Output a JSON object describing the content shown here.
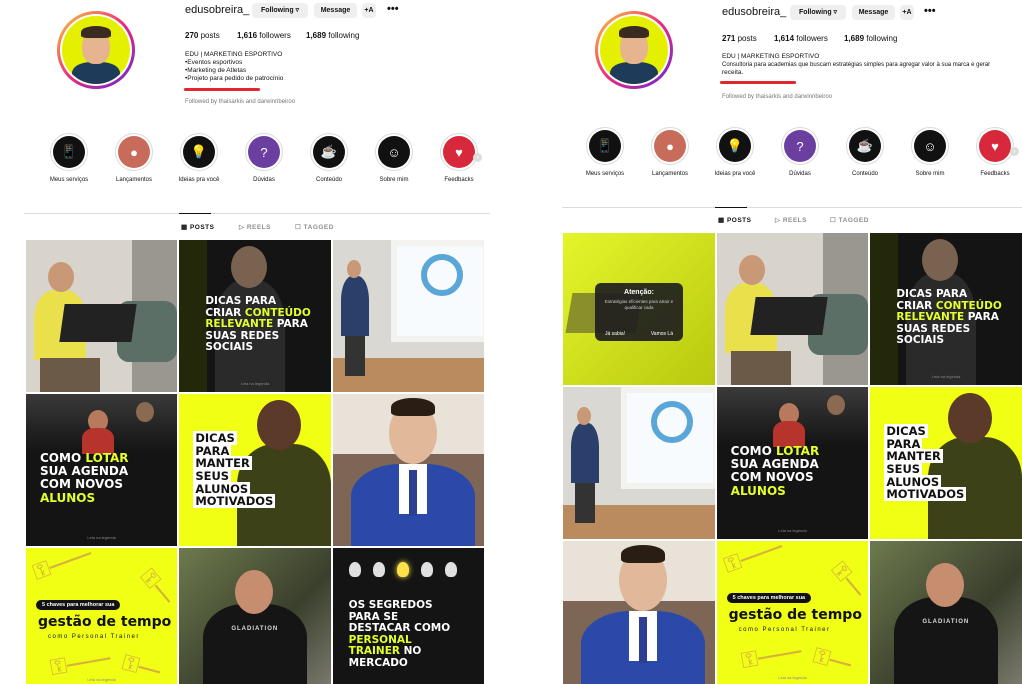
{
  "left": {
    "username": "edusobreira_",
    "buttons": {
      "following": "Following ▿",
      "message": "Message",
      "add": "+A",
      "more": "•••"
    },
    "stats": {
      "posts_n": "270",
      "posts_l": "posts",
      "followers_n": "1,616",
      "followers_l": "followers",
      "following_n": "1,689",
      "following_l": "following"
    },
    "bio": [
      "EDU | MARKETING ESPORTIVO",
      "•Eventos esportivos",
      "•Marketing de Atletas",
      "•Projeto para pedido de patrocínio"
    ],
    "followed_by": "Followed by thaisarkis and darwinribeiroo",
    "highlights": [
      {
        "label": "Meus serviços",
        "icon": "phone-icon"
      },
      {
        "label": "Lançamentos",
        "icon": "photo-icon"
      },
      {
        "label": "Ideias pra você",
        "icon": "bulb-icon"
      },
      {
        "label": "Dúvidas",
        "icon": "question-icon"
      },
      {
        "label": "Conteúdo",
        "icon": "coffee-icon"
      },
      {
        "label": "Sobre mim",
        "icon": "person-icon"
      },
      {
        "label": "Feedbacks",
        "icon": "heart-icon"
      }
    ],
    "tabs": {
      "posts": "POSTS",
      "reels": "REELS",
      "tagged": "TAGGED"
    },
    "posts": {
      "p2": [
        "DICAS PARA",
        "CRIAR",
        "CONTEÚDO",
        "RELEVANTE",
        "PARA",
        "SUAS REDES",
        "SOCIAIS"
      ],
      "p4": [
        "COMO",
        "LOTAR",
        "SUA AGENDA",
        "COM NOVOS",
        "ALUNOS"
      ],
      "p5": [
        "DICAS",
        "PARA",
        "MANTER",
        "SEUS",
        "ALUNOS",
        "MOTIVADOS"
      ],
      "p7": [
        "5 chaves para melhorar sua",
        "gestão de tempo",
        "como Personal Trainer"
      ],
      "p8_shirt": "GLADIATION",
      "p9": [
        "OS SEGREDOS",
        "PARA SE",
        "DESTACAR COMO",
        "PERSONAL",
        "TRAINER",
        "NO",
        "MERCADO"
      ],
      "footer": "Leia na legenda"
    }
  },
  "right": {
    "username": "edusobreira_",
    "buttons": {
      "following": "Following ▿",
      "message": "Message",
      "add": "+A",
      "more": "•••"
    },
    "stats": {
      "posts_n": "271",
      "posts_l": "posts",
      "followers_n": "1,614",
      "followers_l": "followers",
      "following_n": "1,689",
      "following_l": "following"
    },
    "bio": [
      "EDU | MARKETING ESPORTIVO",
      "Consultoria para academias que buscam estratégias simples para agregar valor à sua marca e gerar",
      "receita."
    ],
    "followed_by": "Followed by thaisarkis and darwinribeiroo",
    "highlights": [
      {
        "label": "Meus serviços",
        "icon": "phone-icon"
      },
      {
        "label": "Lançamentos",
        "icon": "photo-icon"
      },
      {
        "label": "Ideias pra você",
        "icon": "bulb-icon"
      },
      {
        "label": "Dúvidas",
        "icon": "question-icon"
      },
      {
        "label": "Conteúdo",
        "icon": "coffee-icon"
      },
      {
        "label": "Sobre mim",
        "icon": "person-icon"
      },
      {
        "label": "Feedbacks",
        "icon": "heart-icon"
      }
    ],
    "tabs": {
      "posts": "POSTS",
      "reels": "REELS",
      "tagged": "TAGGED"
    },
    "modal": {
      "title": "Atenção:",
      "body": "Estratégias eficientes para atrair e qualificar cada",
      "btn1": "Já sabia!",
      "btn2": "Vamos Lá"
    },
    "posts": {
      "p3": [
        "DICAS PARA",
        "CRIAR",
        "CONTEÚDO",
        "RELEVANTE",
        "PARA",
        "SUAS REDES",
        "SOCIAIS"
      ],
      "p5": [
        "COMO",
        "LOTAR",
        "SUA AGENDA",
        "COM NOVOS",
        "ALUNOS"
      ],
      "p6": [
        "DICAS",
        "PARA",
        "MANTER",
        "SEUS",
        "ALUNOS",
        "MOTIVADOS"
      ],
      "p8": [
        "5 chaves para melhorar sua",
        "gestão de tempo",
        "como Personal Trainer"
      ],
      "p9_shirt": "GLADIATION",
      "footer": "Leia na legenda"
    }
  }
}
